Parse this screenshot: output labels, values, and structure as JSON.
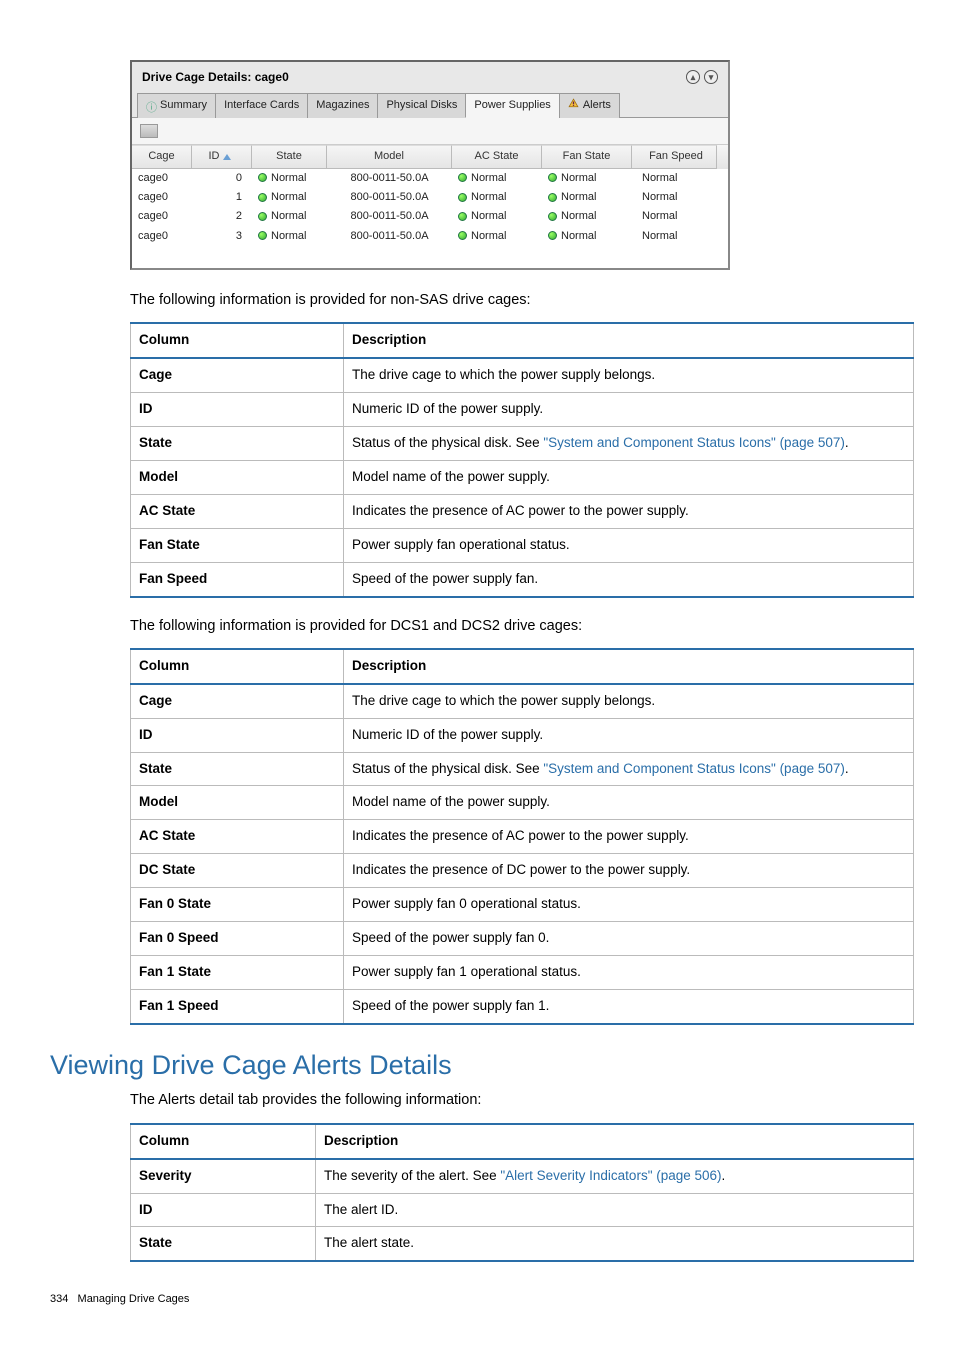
{
  "panel": {
    "title": "Drive Cage Details: cage0",
    "tabs": [
      "Summary",
      "Interface Cards",
      "Magazines",
      "Physical Disks",
      "Power Supplies",
      "Alerts"
    ],
    "active_tab": "Power Supplies",
    "columns": {
      "cage": "Cage",
      "id": "ID",
      "state": "State",
      "model": "Model",
      "ac": "AC State",
      "fan": "Fan State",
      "speed": "Fan Speed"
    },
    "rows": [
      {
        "cage": "cage0",
        "id": "0",
        "state": "Normal",
        "model": "800-0011-50.0A",
        "ac": "Normal",
        "fan": "Normal",
        "speed": "Normal"
      },
      {
        "cage": "cage0",
        "id": "1",
        "state": "Normal",
        "model": "800-0011-50.0A",
        "ac": "Normal",
        "fan": "Normal",
        "speed": "Normal"
      },
      {
        "cage": "cage0",
        "id": "2",
        "state": "Normal",
        "model": "800-0011-50.0A",
        "ac": "Normal",
        "fan": "Normal",
        "speed": "Normal"
      },
      {
        "cage": "cage0",
        "id": "3",
        "state": "Normal",
        "model": "800-0011-50.0A",
        "ac": "Normal",
        "fan": "Normal",
        "speed": "Normal"
      }
    ]
  },
  "text": {
    "para1": "The following information is provided for non-SAS drive cages:",
    "para2": "The following information is provided for DCS1 and DCS2 drive cages:",
    "col_h": "Column",
    "desc_h": "Description"
  },
  "table1": [
    {
      "c": "Cage",
      "d": "The drive cage to which the power supply belongs."
    },
    {
      "c": "ID",
      "d": "Numeric ID of the power supply."
    },
    {
      "c": "State",
      "d_pre": "Status of the physical disk. See ",
      "link": "\"System and Component Status Icons\" (page 507)",
      "d_post": "."
    },
    {
      "c": "Model",
      "d": "Model name of the power supply."
    },
    {
      "c": "AC State",
      "d": "Indicates the presence of AC power to the power supply."
    },
    {
      "c": "Fan State",
      "d": "Power supply fan operational status."
    },
    {
      "c": "Fan Speed",
      "d": "Speed of the power supply fan."
    }
  ],
  "table2": [
    {
      "c": "Cage",
      "d": "The drive cage to which the power supply belongs."
    },
    {
      "c": "ID",
      "d": "Numeric ID of the power supply."
    },
    {
      "c": "State",
      "d_pre": "Status of the physical disk. See ",
      "link": "\"System and Component Status Icons\" (page 507)",
      "d_post": "."
    },
    {
      "c": "Model",
      "d": "Model name of the power supply."
    },
    {
      "c": "AC State",
      "d": "Indicates the presence of AC power to the power supply."
    },
    {
      "c": "DC State",
      "d": "Indicates the presence of DC power to the power supply."
    },
    {
      "c": "Fan 0 State",
      "d": "Power supply fan 0 operational status."
    },
    {
      "c": "Fan 0 Speed",
      "d": "Speed of the power supply fan 0."
    },
    {
      "c": "Fan 1 State",
      "d": "Power supply fan 1 operational status."
    },
    {
      "c": "Fan 1 Speed",
      "d": "Speed of the power supply fan 1."
    }
  ],
  "section2": {
    "heading": "Viewing Drive Cage Alerts Details",
    "para": "The Alerts detail tab provides the following information:"
  },
  "table3": [
    {
      "c": "Severity",
      "d_pre": "The severity of the alert. See ",
      "link": "\"Alert Severity Indicators\" (page 506)",
      "d_post": "."
    },
    {
      "c": "ID",
      "d": "The alert ID."
    },
    {
      "c": "State",
      "d": "The alert state."
    }
  ],
  "footer": {
    "page": "334",
    "chapter": "Managing Drive Cages"
  }
}
